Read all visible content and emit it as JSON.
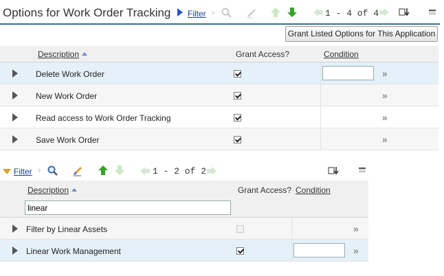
{
  "top": {
    "title": "Options for Work Order Tracking",
    "filter_label": "Filter",
    "pagination": "1 - 4 of 4",
    "grant_button": "Grant Listed Options for This Application",
    "columns": {
      "description": "Description",
      "grant_access": "Grant Access?",
      "condition": "Condition"
    },
    "rows": [
      {
        "description": "Delete Work Order",
        "granted": true,
        "condition": ""
      },
      {
        "description": "New Work Order",
        "granted": true,
        "condition": ""
      },
      {
        "description": "Read access to Work Order Tracking",
        "granted": true,
        "condition": ""
      },
      {
        "description": "Save Work Order",
        "granted": true,
        "condition": ""
      }
    ]
  },
  "bottom": {
    "filter_label": "Filter",
    "pagination": "1 - 2 of 2",
    "columns": {
      "description": "Description",
      "grant_access": "Grant Access?",
      "condition": "Condition"
    },
    "filter_value": "linear",
    "rows": [
      {
        "description": "Filter by Linear Assets",
        "granted": false,
        "disabled": true,
        "condition": ""
      },
      {
        "description": "Linear Work Management",
        "granted": true,
        "disabled": false,
        "condition": ""
      }
    ]
  },
  "icons": {
    "filter_arrow": "blue-right-triangle",
    "filter_open_arrow": "orange-down-triangle",
    "search": "magnifier-icon",
    "clear_filter": "eraser-icon",
    "prev_set": "up-arrow-icon",
    "next_set": "down-arrow-icon",
    "prev_page": "left-arrow-icon",
    "next_page": "right-arrow-icon",
    "download": "download-icon",
    "collapse": "minimize-icon",
    "row_details": "double-chevron-icon",
    "expander": "row-expand-triangle"
  },
  "colors": {
    "accent_rule": "#3a6f86",
    "link": "#1a3e9e",
    "highlight_row": "#e4f1f8",
    "green_arrow": "#3aa02a"
  }
}
